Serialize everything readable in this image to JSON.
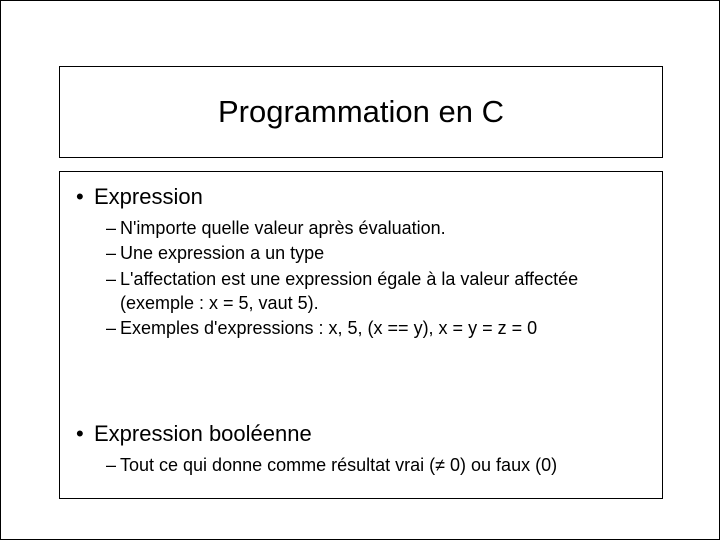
{
  "title": "Programmation en C",
  "sections": [
    {
      "heading": "Expression",
      "items": [
        "N'importe quelle valeur après évaluation.",
        "Une expression a un type",
        "L'affectation est une expression égale à la valeur affectée (exemple : x = 5, vaut 5).",
        "Exemples d'expressions : x, 5, (x == y), x = y = z = 0"
      ]
    },
    {
      "heading": "Expression booléenne",
      "items": [
        "Tout ce qui donne comme résultat vrai (≠ 0) ou faux (0)"
      ]
    }
  ]
}
